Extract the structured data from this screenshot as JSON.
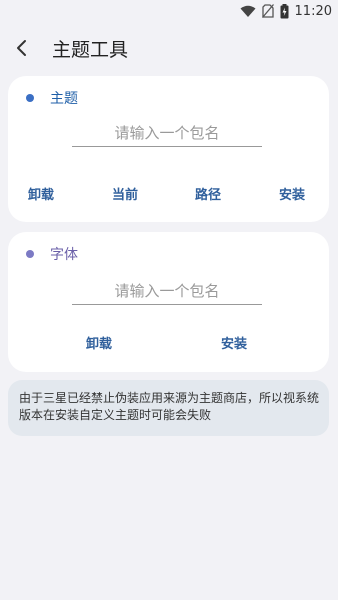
{
  "status_bar": {
    "time": "11:20"
  },
  "header": {
    "title": "主题工具"
  },
  "theme_card": {
    "label": "主题",
    "label_color": "#1f5fa8",
    "dot_color": "#3b6fc4",
    "input_placeholder": "请输入一个包名",
    "input_value": "",
    "actions": [
      "卸载",
      "当前",
      "路径",
      "安装"
    ]
  },
  "font_card": {
    "label": "字体",
    "label_color": "#6a5fa8",
    "dot_color": "#7c7ac4",
    "input_placeholder": "请输入一个包名",
    "input_value": "",
    "actions": [
      "卸载",
      "安装"
    ]
  },
  "notice": {
    "text": "由于三星已经禁止伪装应用来源为主题商店，所以视系统版本在安装自定义主题时可能会失败"
  },
  "colors": {
    "background": "#f2f2f6",
    "card": "#ffffff",
    "notice_bg": "#e3e8ee",
    "action_text": "#2f5f9c"
  }
}
